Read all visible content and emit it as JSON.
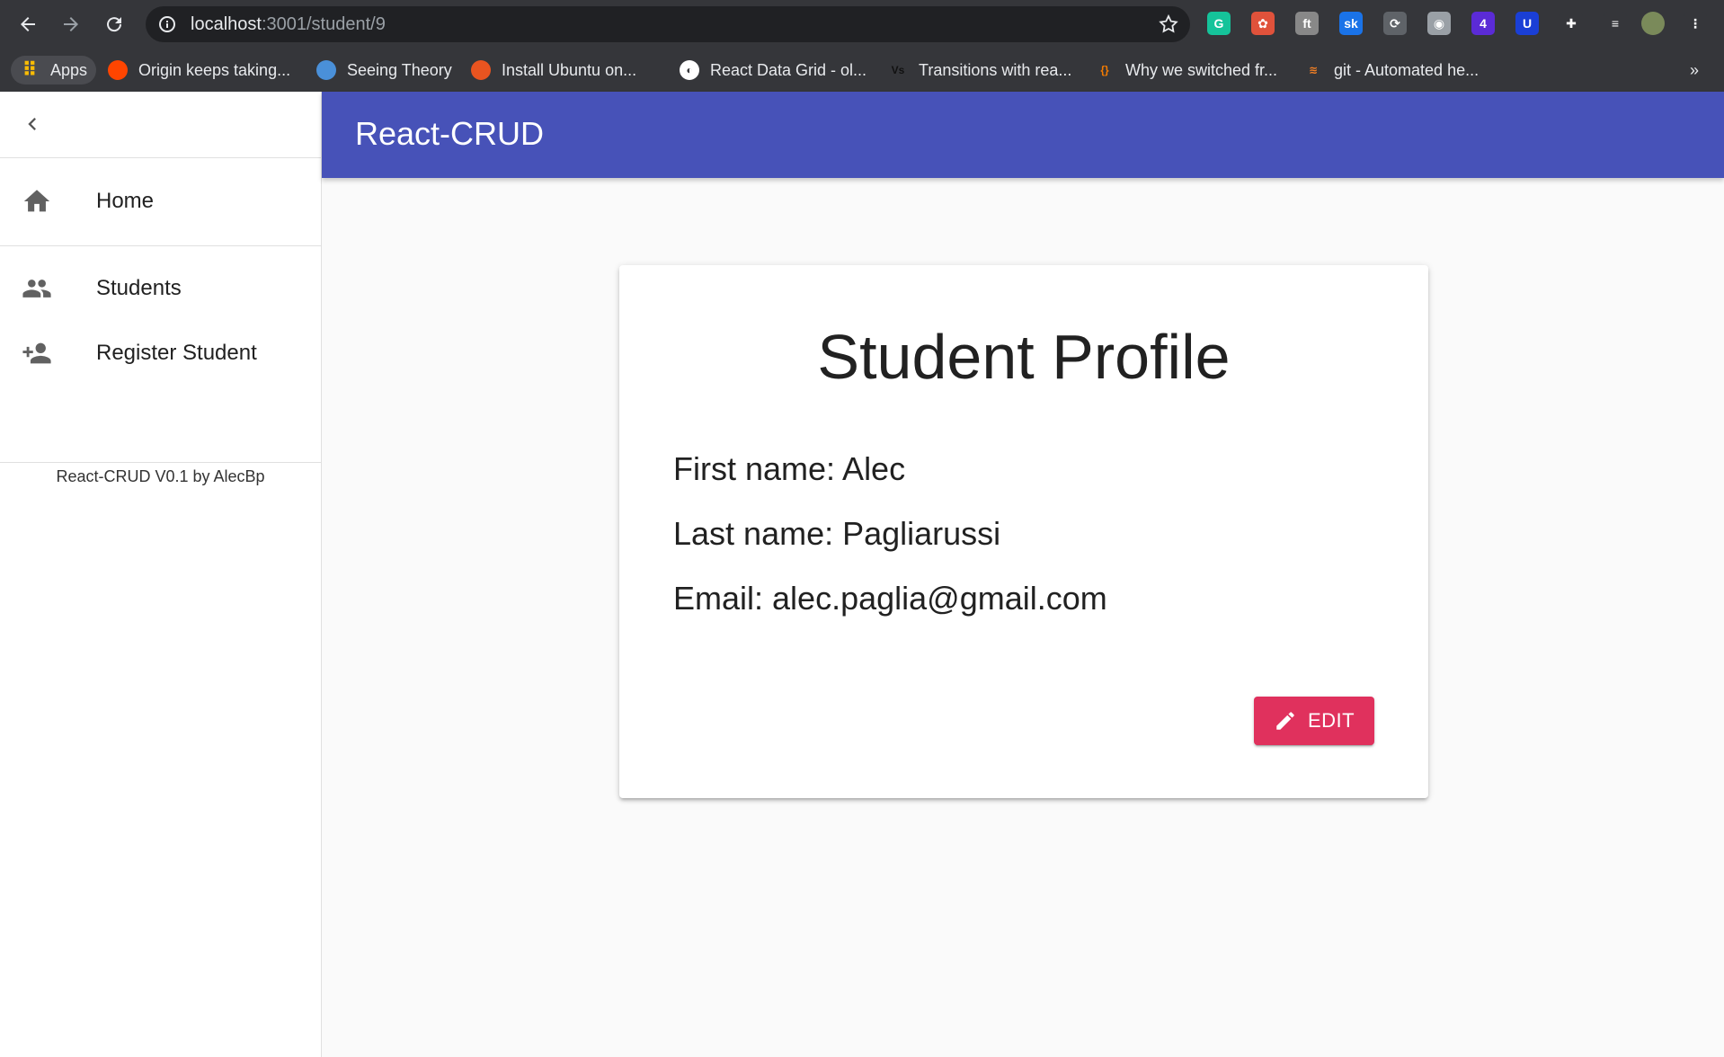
{
  "browser": {
    "url_host": "localhost",
    "url_path": ":3001/student/9",
    "nav": {
      "back_icon": "arrow-left-icon",
      "forward_icon": "arrow-right-icon",
      "reload_icon": "reload-icon"
    },
    "extensions": [
      {
        "name": "grammarly-icon",
        "glyph": "G",
        "color": "#15c39a"
      },
      {
        "name": "palette-extension-icon",
        "glyph": "✿",
        "color": "#e0523b"
      },
      {
        "name": "fonts-extension-icon",
        "glyph": "ft",
        "color": "#888888"
      },
      {
        "name": "sk-extension-icon",
        "glyph": "sk",
        "color": "#1a73e8"
      },
      {
        "name": "sync-extension-icon",
        "glyph": "⟳",
        "color": "#5f6368"
      },
      {
        "name": "camera-extension-icon",
        "glyph": "◉",
        "color": "#9aa0a6"
      },
      {
        "name": "tab-extension-icon",
        "glyph": "4",
        "color": "#5b2bd6"
      },
      {
        "name": "shield-extension-icon",
        "glyph": "U",
        "color": "#1a3fd6"
      },
      {
        "name": "puzzle-extensions-icon",
        "glyph": "✚",
        "color": "#35363a"
      },
      {
        "name": "reading-list-icon",
        "glyph": "≡",
        "color": "#35363a"
      },
      {
        "name": "profile-avatar-icon",
        "glyph": "",
        "color": "#7a8a5a"
      },
      {
        "name": "menu-kebab-icon",
        "glyph": "⋮",
        "color": "#35363a"
      }
    ],
    "bookmarks": [
      {
        "label": "Apps",
        "icon": "apps-grid-icon",
        "color": "#4a4b50"
      },
      {
        "label": "Origin keeps taking...",
        "icon": "reddit-icon",
        "color": "#ff4500"
      },
      {
        "label": "Seeing Theory",
        "icon": "circle-icon",
        "color": "#4a90d9"
      },
      {
        "label": "Install Ubuntu on...",
        "icon": "ubuntu-icon",
        "color": "#e95420"
      },
      {
        "label": "React Data Grid - ol...",
        "icon": "globe-icon",
        "color": "#ffffff"
      },
      {
        "label": "Transitions with rea...",
        "icon": "vs-icon",
        "color": "#35363a"
      },
      {
        "label": "Why we switched fr...",
        "icon": "brackets-icon",
        "color": "#35363a"
      },
      {
        "label": "git - Automated he...",
        "icon": "stackoverflow-icon",
        "color": "#35363a"
      }
    ],
    "overflow": "»"
  },
  "app": {
    "title": "React-CRUD",
    "brand_color": "#4752b8",
    "accent_color": "#e0315d"
  },
  "sidebar": {
    "back_icon": "chevron-left-icon",
    "items": [
      {
        "label": "Home",
        "icon": "home-icon"
      },
      {
        "label": "Students",
        "icon": "people-icon"
      },
      {
        "label": "Register Student",
        "icon": "person-add-icon"
      }
    ],
    "footer": "React-CRUD V0.1 by AlecBp"
  },
  "profile": {
    "heading": "Student Profile",
    "first_name": "First name: Alec",
    "last_name": "Last name: Pagliarussi",
    "email": "Email: alec.paglia@gmail.com",
    "edit_label": "EDIT",
    "edit_icon": "pencil-icon"
  }
}
